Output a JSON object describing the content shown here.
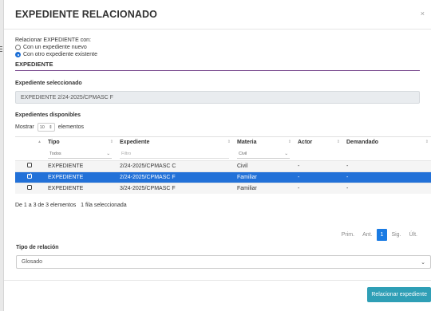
{
  "modal": {
    "title": "EXPEDIENTE RELACIONADO",
    "close": "×"
  },
  "relate": {
    "label": "Relacionar EXPEDIENTE con:",
    "options": [
      {
        "label": "Con un expediente nuevo",
        "checked": false
      },
      {
        "label": "Con otro expediente existente",
        "checked": true
      }
    ]
  },
  "section": {
    "title": "EXPEDIENTE"
  },
  "selected_expediente": {
    "label": "Expediente seleccionado",
    "value": "EXPEDIENTE 2/24-2025/CPMASC F"
  },
  "available": {
    "label": "Expedientes disponibles",
    "show_prefix": "Mostrar",
    "page_size": "10",
    "show_suffix": "elementos"
  },
  "table": {
    "headers": [
      "Tipo",
      "Expediente",
      "Materia",
      "Actor",
      "Demandado"
    ],
    "filters": {
      "tipo": "Todos",
      "expediente_placeholder": "Filtro",
      "materia": "Civil"
    },
    "rows": [
      {
        "tipo": "EXPEDIENTE",
        "expediente": "2/24-2025/CPMASC C",
        "materia": "Civil",
        "actor": "-",
        "demandado": "-",
        "selected": false
      },
      {
        "tipo": "EXPEDIENTE",
        "expediente": "2/24-2025/CPMASC F",
        "materia": "Familiar",
        "actor": "-",
        "demandado": "-",
        "selected": true
      },
      {
        "tipo": "EXPEDIENTE",
        "expediente": "3/24-2025/CPMASC F",
        "materia": "Familiar",
        "actor": "-",
        "demandado": "-",
        "selected": false
      }
    ]
  },
  "info": "De 1 a 3 de 3 elementos   1 fila seleccionada",
  "pager": [
    "Prim.",
    "Ant.",
    "1",
    "Sig.",
    "Últ."
  ],
  "relation": {
    "label": "Tipo de relación",
    "value": "Glosado"
  },
  "submit_label": "Relacionar expediente",
  "colors": {
    "accent": "#2271d8",
    "section_line": "#7a4a8f",
    "button": "#2f9fb6"
  }
}
